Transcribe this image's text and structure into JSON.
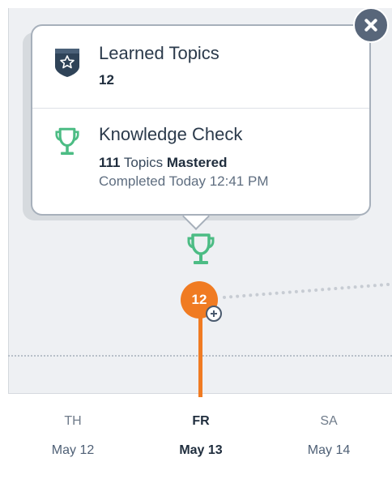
{
  "popover": {
    "learned": {
      "title": "Learned Topics",
      "value": "12",
      "icon": "shield-star-icon"
    },
    "check": {
      "title": "Knowledge Check",
      "topics_count": "111",
      "topics_word": "Topics",
      "mastered_word": "Mastered",
      "completed": "Completed Today 12:41 PM",
      "icon": "trophy-icon"
    },
    "close_icon": "close-icon"
  },
  "timeline": {
    "node_value": "12",
    "trophy_icon": "trophy-icon",
    "add_icon": "plus-circle-icon",
    "accent_color": "#f07b22",
    "trophy_color": "#4cbc84"
  },
  "days": [
    {
      "dow": "TH",
      "date": "May 12",
      "active": false
    },
    {
      "dow": "FR",
      "date": "May 13",
      "active": true
    },
    {
      "dow": "SA",
      "date": "May 14",
      "active": false
    }
  ]
}
